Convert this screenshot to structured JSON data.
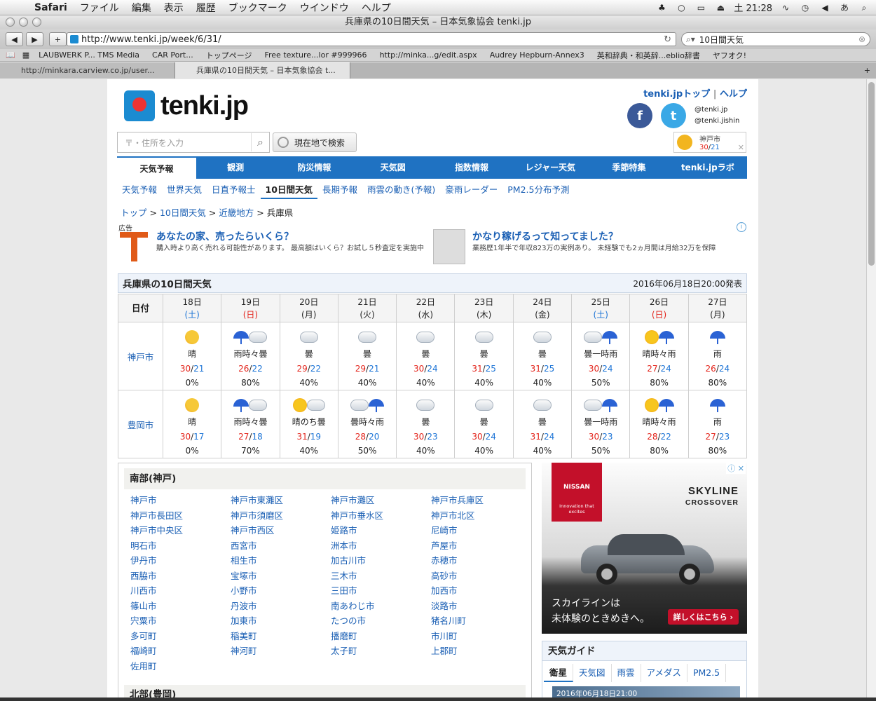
{
  "menubar": {
    "app": "Safari",
    "items": [
      "ファイル",
      "編集",
      "表示",
      "履歴",
      "ブックマーク",
      "ウインドウ",
      "ヘルプ"
    ],
    "clock": "土 21:28"
  },
  "window": {
    "title": "兵庫県の10日間天気 – 日本気象協会 tenki.jp",
    "url": "http://www.tenki.jp/week/6/31/",
    "search_value": "10日間天気"
  },
  "bookmarks": [
    "LAUBWERK P... TMS Media",
    "CAR Port...",
    "トップページ",
    "Free texture...lor #999966",
    "http://minka...g/edit.aspx",
    "Audrey Hepburn-Annex3",
    "英和辞典・和英辞...eblio辞書",
    "ヤフオク!"
  ],
  "tabs": [
    {
      "label": "http://minkara.carview.co.jp/user..."
    },
    {
      "label": "兵庫県の10日間天気 – 日本気象協会 t..."
    }
  ],
  "site": {
    "logo": "tenki.jp",
    "top_link": "tenki.jpトップ",
    "help_link": "ヘルプ",
    "twitter1": "@tenki.jp",
    "twitter2": "@tenki.jishin",
    "facebook_glyph": "f",
    "twitter_glyph": "t",
    "city_widget": {
      "name": "神戸市",
      "hi": "30",
      "lo": "21"
    },
    "search_placeholder": "〒・住所を入力",
    "geo_button": "現在地で検索"
  },
  "nav": [
    "天気予報",
    "観測",
    "防災情報",
    "天気図",
    "指数情報",
    "レジャー天気",
    "季節特集",
    "tenki.jpラボ"
  ],
  "subnav": [
    "天気予報",
    "世界天気",
    "日直予報士",
    "10日間天気",
    "長期予報",
    "雨雲の動き(予報)",
    "豪雨レーダー",
    "PM2.5分布予測"
  ],
  "breadcrumb": [
    "トップ",
    "10日間天気",
    "近畿地方",
    "兵庫県"
  ],
  "ads": {
    "label": "広告",
    "ad1_title": "あなたの家、売ったらいくら？",
    "ad1_desc": "購入時より高く売れる可能性があります。 最高額はいくら？お試し５秒査定を実施中",
    "ad2_title": "かなり稼げるって知ってました？",
    "ad2_desc": "業務歴1年半で年収823万の実例あり。 未経験でも2ヵ月間は月給32万を保障"
  },
  "forecast": {
    "title": "兵庫県の10日間天気",
    "published": "2016年06月18日20:00発表",
    "date_header": "日付",
    "days": [
      {
        "date": "18日",
        "dow": "(土)",
        "kind": "sat"
      },
      {
        "date": "19日",
        "dow": "(日)",
        "kind": "sun"
      },
      {
        "date": "20日",
        "dow": "(月)",
        "kind": ""
      },
      {
        "date": "21日",
        "dow": "(火)",
        "kind": ""
      },
      {
        "date": "22日",
        "dow": "(水)",
        "kind": ""
      },
      {
        "date": "23日",
        "dow": "(木)",
        "kind": ""
      },
      {
        "date": "24日",
        "dow": "(金)",
        "kind": ""
      },
      {
        "date": "25日",
        "dow": "(土)",
        "kind": "sat"
      },
      {
        "date": "26日",
        "dow": "(日)",
        "kind": "sun"
      },
      {
        "date": "27日",
        "dow": "(月)",
        "kind": ""
      }
    ],
    "cities": [
      {
        "name": "神戸市",
        "cells": [
          {
            "icon": [
              "moon"
            ],
            "cond": "晴",
            "hi": "30",
            "lo": "21",
            "pop": "0%"
          },
          {
            "icon": [
              "umb",
              "cloud"
            ],
            "cond": "雨時々曇",
            "hi": "26",
            "lo": "22",
            "pop": "80%"
          },
          {
            "icon": [
              "cloud"
            ],
            "cond": "曇",
            "hi": "29",
            "lo": "22",
            "pop": "40%"
          },
          {
            "icon": [
              "cloud"
            ],
            "cond": "曇",
            "hi": "29",
            "lo": "21",
            "pop": "40%"
          },
          {
            "icon": [
              "cloud"
            ],
            "cond": "曇",
            "hi": "30",
            "lo": "24",
            "pop": "40%"
          },
          {
            "icon": [
              "cloud"
            ],
            "cond": "曇",
            "hi": "31",
            "lo": "25",
            "pop": "40%"
          },
          {
            "icon": [
              "cloud"
            ],
            "cond": "曇",
            "hi": "31",
            "lo": "25",
            "pop": "40%"
          },
          {
            "icon": [
              "cloud",
              "umb"
            ],
            "cond": "曇一時雨",
            "hi": "30",
            "lo": "24",
            "pop": "50%"
          },
          {
            "icon": [
              "sun",
              "umb"
            ],
            "cond": "晴時々雨",
            "hi": "27",
            "lo": "24",
            "pop": "80%"
          },
          {
            "icon": [
              "umb"
            ],
            "cond": "雨",
            "hi": "26",
            "lo": "24",
            "pop": "80%"
          }
        ]
      },
      {
        "name": "豊岡市",
        "cells": [
          {
            "icon": [
              "moon"
            ],
            "cond": "晴",
            "hi": "30",
            "lo": "17",
            "pop": "0%"
          },
          {
            "icon": [
              "umb",
              "cloud"
            ],
            "cond": "雨時々曇",
            "hi": "27",
            "lo": "18",
            "pop": "70%"
          },
          {
            "icon": [
              "sun",
              "cloud"
            ],
            "cond": "晴のち曇",
            "hi": "31",
            "lo": "19",
            "pop": "40%"
          },
          {
            "icon": [
              "cloud",
              "umb"
            ],
            "cond": "曇時々雨",
            "hi": "28",
            "lo": "20",
            "pop": "50%"
          },
          {
            "icon": [
              "cloud"
            ],
            "cond": "曇",
            "hi": "30",
            "lo": "23",
            "pop": "40%"
          },
          {
            "icon": [
              "cloud"
            ],
            "cond": "曇",
            "hi": "30",
            "lo": "24",
            "pop": "40%"
          },
          {
            "icon": [
              "cloud"
            ],
            "cond": "曇",
            "hi": "31",
            "lo": "24",
            "pop": "40%"
          },
          {
            "icon": [
              "cloud",
              "umb"
            ],
            "cond": "曇一時雨",
            "hi": "30",
            "lo": "23",
            "pop": "50%"
          },
          {
            "icon": [
              "sun",
              "umb"
            ],
            "cond": "晴時々雨",
            "hi": "28",
            "lo": "22",
            "pop": "80%"
          },
          {
            "icon": [
              "umb"
            ],
            "cond": "雨",
            "hi": "27",
            "lo": "23",
            "pop": "80%"
          }
        ]
      }
    ]
  },
  "regions": {
    "south_title": "南部(神戸)",
    "south": [
      "神戸市",
      "神戸市東灘区",
      "神戸市灘区",
      "神戸市兵庫区",
      "神戸市長田区",
      "神戸市須磨区",
      "神戸市垂水区",
      "神戸市北区",
      "神戸市中央区",
      "神戸市西区",
      "姫路市",
      "尼崎市",
      "明石市",
      "西宮市",
      "洲本市",
      "芦屋市",
      "伊丹市",
      "相生市",
      "加古川市",
      "赤穂市",
      "西脇市",
      "宝塚市",
      "三木市",
      "高砂市",
      "川西市",
      "小野市",
      "三田市",
      "加西市",
      "篠山市",
      "丹波市",
      "南あわじ市",
      "淡路市",
      "宍粟市",
      "加東市",
      "たつの市",
      "猪名川町",
      "多可町",
      "稲美町",
      "播磨町",
      "市川町",
      "福崎町",
      "神河町",
      "太子町",
      "上郡町",
      "佐用町"
    ],
    "north_title": "北部(豊岡)"
  },
  "side_ad": {
    "brand": "NISSAN",
    "brand_sub": "Innovation that excites",
    "model": "SKYLINE",
    "model_sub": "CROSSOVER",
    "copy1": "スカイラインは",
    "copy2": "未体験のときめきへ。",
    "cta": "詳しくはこちら ›"
  },
  "guide": {
    "title": "天気ガイド",
    "tabs": [
      "衛星",
      "天気図",
      "雨雲",
      "アメダス",
      "PM2.5"
    ],
    "image_caption": "2016年06月18日21:00"
  },
  "colors": {
    "nav": "#1f72c2",
    "high": "#e3241b",
    "low": "#1c74d6",
    "brand": "#c3102a"
  }
}
